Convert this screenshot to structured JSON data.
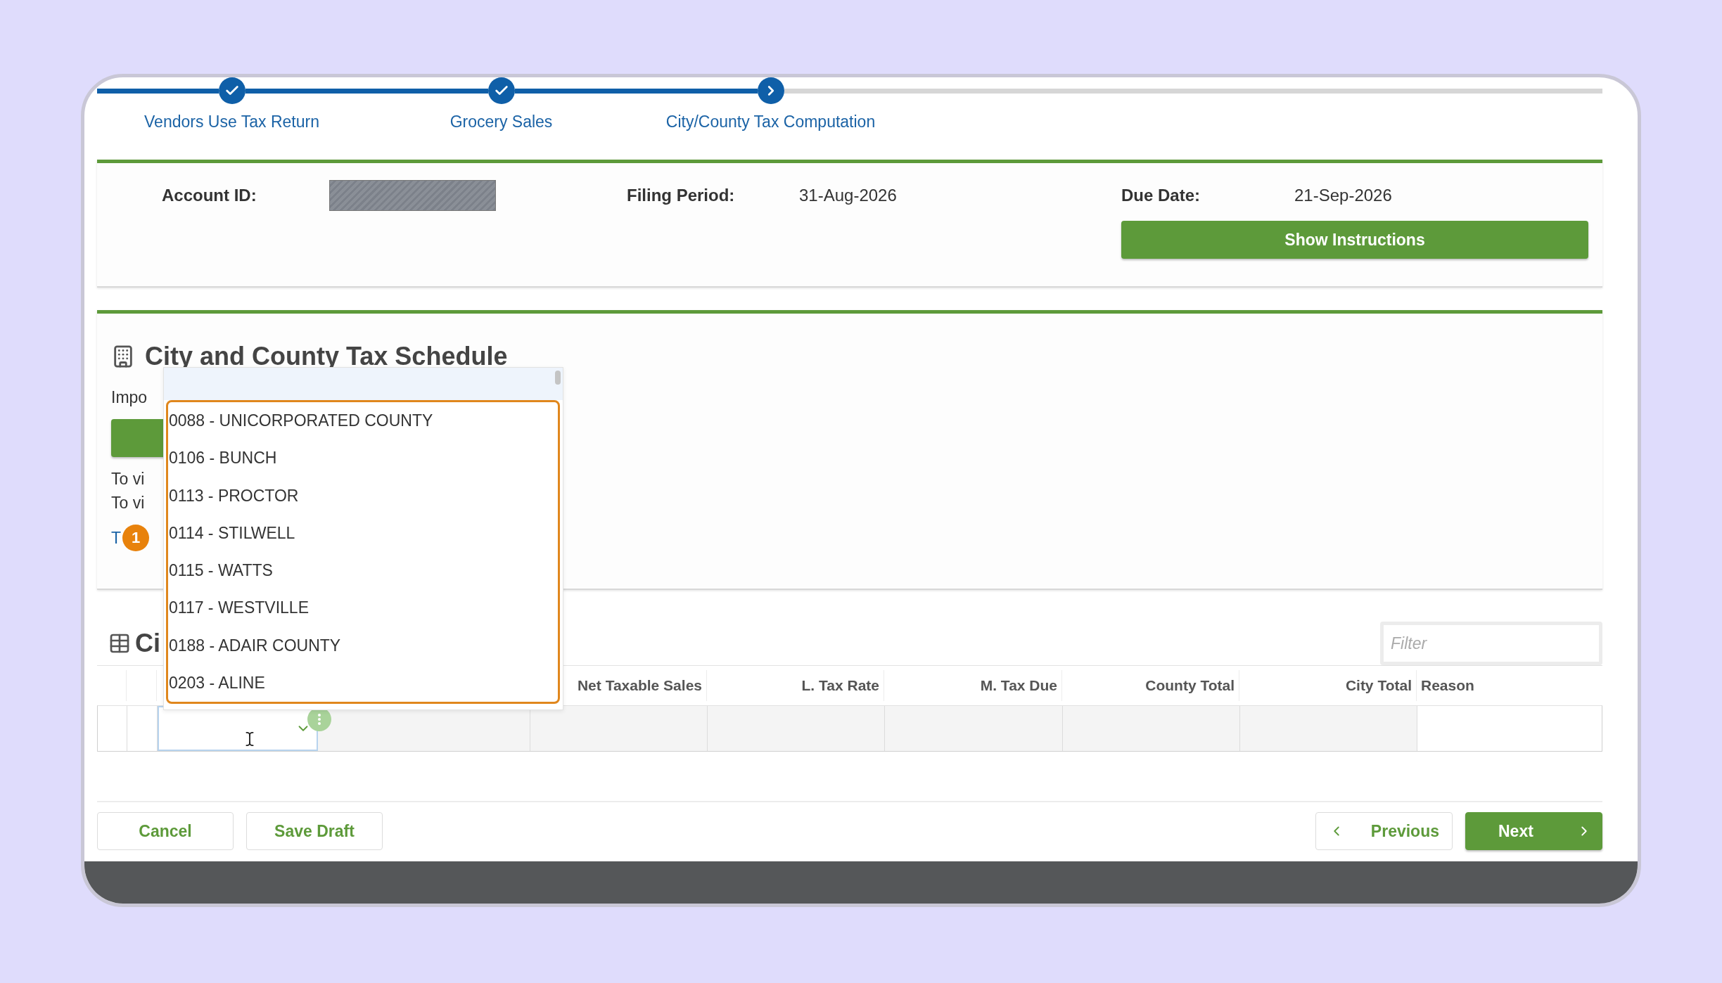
{
  "steps": [
    {
      "label": "Vendors Use Tax Return",
      "done": true,
      "current": false
    },
    {
      "label": "Grocery Sales",
      "done": true,
      "current": false
    },
    {
      "label": "City/County Tax Computation",
      "done": false,
      "current": true
    }
  ],
  "account": {
    "fields": [
      {
        "label": "Account ID:",
        "redacted": true
      },
      {
        "label": "Filing Period:",
        "value": "31-Aug-2026"
      },
      {
        "label": "Due Date:",
        "value": "21-Sep-2026"
      }
    ],
    "instructions_button": "Show Instructions"
  },
  "schedule": {
    "title": "City and County Tax Schedule",
    "intro": "Impo",
    "notes": [
      "To vi",
      "To vi"
    ],
    "link": "T",
    "badge": "1"
  },
  "dropdown": {
    "options": [
      "0088 - UNICORPORATED COUNTY",
      "0106 - BUNCH",
      "0113 - PROCTOR",
      "0114 - STILWELL",
      "0115 - WATTS",
      "0117 - WESTVILLE",
      "0188 - ADAIR COUNTY",
      "0203 - ALINE"
    ]
  },
  "table": {
    "title": "Ci",
    "filter_placeholder": "Filter",
    "columns": [
      "Net Taxable Sales",
      "L. Tax Rate",
      "M. Tax Due",
      "County Total",
      "City Total",
      "Reason"
    ]
  },
  "footer": {
    "cancel": "Cancel",
    "save_draft": "Save Draft",
    "previous": "Previous",
    "next": "Next"
  }
}
